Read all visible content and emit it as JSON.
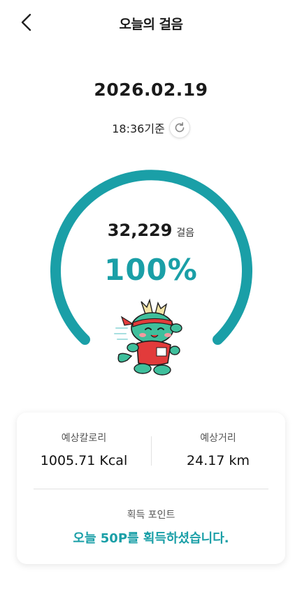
{
  "header": {
    "title": "오늘의 걸음",
    "back_icon": "chevron-left-icon"
  },
  "summary": {
    "date": "2026.02.19",
    "as_of": "18:36기준",
    "refresh_icon": "refresh-icon"
  },
  "gauge": {
    "steps": "32,229",
    "steps_unit": "걸음",
    "percent_text": "100%",
    "progress_fraction": 1.0,
    "color": "#1a9fa7",
    "mascot": "dragon-mascot"
  },
  "stats": {
    "calories_label": "예상칼로리",
    "calories_value": "1005.71 Kcal",
    "distance_label": "예상거리",
    "distance_value": "24.17 km"
  },
  "points": {
    "label": "획득 포인트",
    "message": "오늘 50P를 획득하셨습니다."
  }
}
